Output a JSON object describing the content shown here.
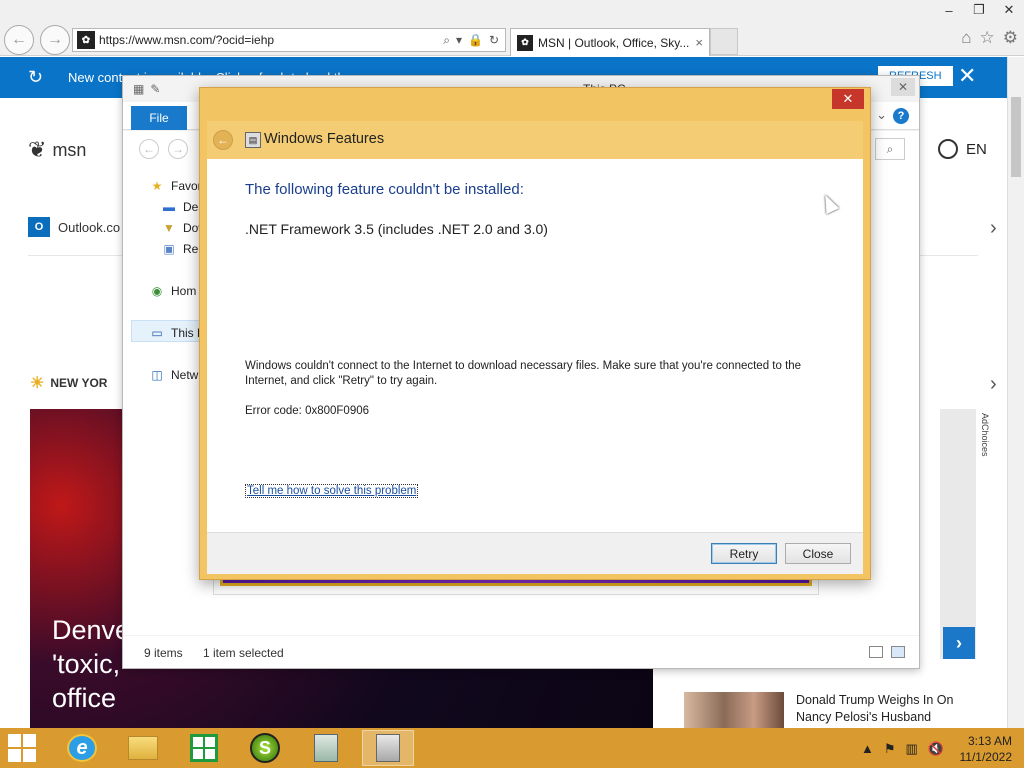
{
  "browser": {
    "url": "https://www.msn.com/?ocid=iehp",
    "tab_title": "MSN | Outlook, Office, Sky...",
    "tab_close": "×",
    "back": "←",
    "forward": "→"
  },
  "window_controls": {
    "minimize": "–",
    "restore": "❐",
    "close": "✕"
  },
  "msn": {
    "notification_text": "New content is available. Click refresh to load the",
    "refresh_label": "REFRESH",
    "close_label": "✕",
    "logo_text": "msn",
    "language": "EN",
    "outlook_label": "Outlook.co",
    "weather_city": "NEW YOR",
    "hero_headline": "Denve 'toxic, office",
    "news_headline": "Donald Trump Weighs In On Nancy Pelosi's Husband",
    "ad_choices": "AdChoices"
  },
  "explorer": {
    "title": "This PC",
    "file_tab": "File",
    "help": "?",
    "nav_items": [
      "Favor",
      "Des",
      "Dow",
      "Rec",
      "Hom",
      "This P",
      "Netw"
    ],
    "status_items": "9 items",
    "status_selected": "1 item selected"
  },
  "dialog": {
    "title": "Windows Features",
    "close": "✕",
    "heading": "The following feature couldn't be installed:",
    "feature": ".NET Framework 3.5 (includes .NET 2.0 and 3.0)",
    "message": "Windows couldn't connect to the Internet to download necessary files. Make sure that you're connected to the Internet, and click \"Retry\" to try again.",
    "error_code": "Error code: 0x800F0906",
    "help_link": "Tell me how to solve this problem",
    "retry": "Retry",
    "close_button": "Close"
  },
  "taskbar": {
    "apps": [
      "internet-explorer",
      "file-explorer",
      "store",
      "s-app",
      "recycle-app",
      "system-app"
    ],
    "time": "3:13 AM",
    "date": "11/1/2022"
  },
  "colors": {
    "taskbar": "#d99a2f",
    "dialog_frame": "#f2c462",
    "msn_blue": "#0a74c8",
    "close_red": "#c7362b"
  }
}
